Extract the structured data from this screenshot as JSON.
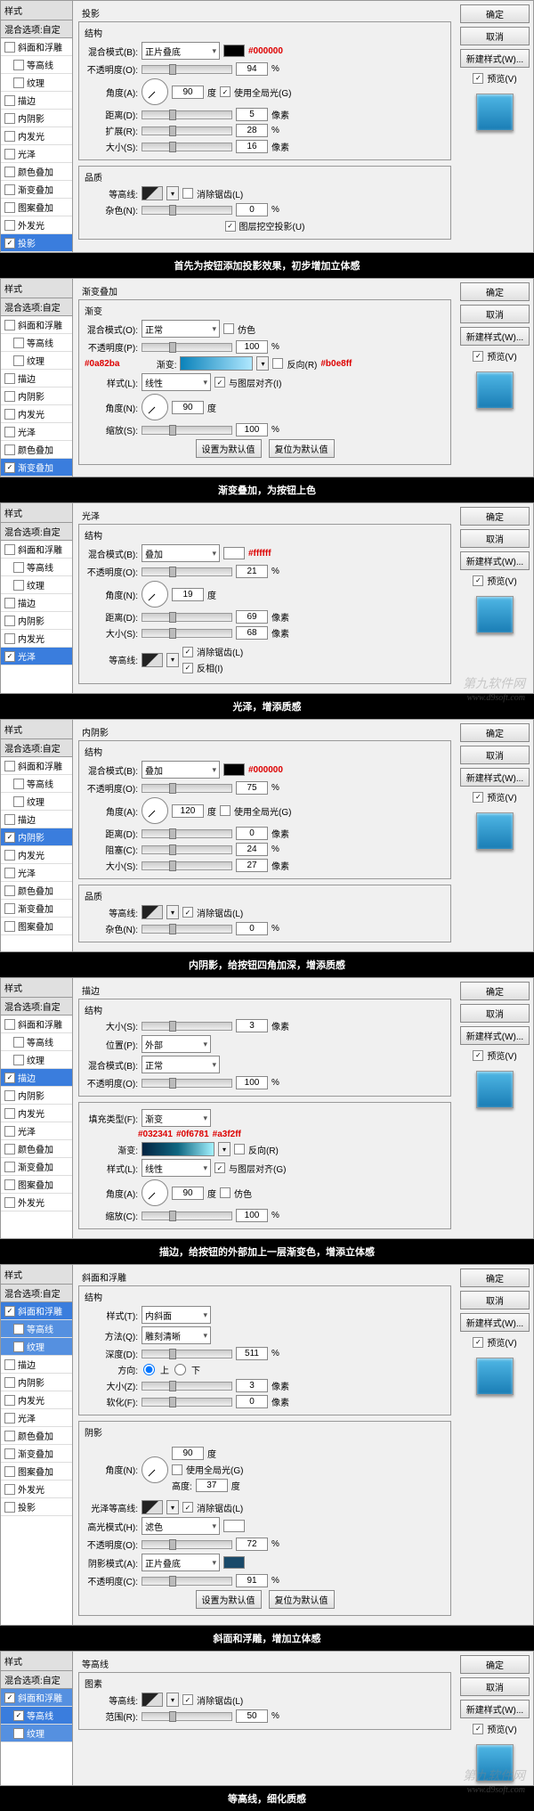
{
  "panels": [
    {
      "sidebar": {
        "hdr": "样式",
        "sub": "混合选项:自定",
        "items": [
          {
            "label": "斜面和浮雕",
            "cb": false
          },
          {
            "label": "等高线",
            "cb": false,
            "indent": 1
          },
          {
            "label": "纹理",
            "cb": false,
            "indent": 1
          },
          {
            "label": "描边",
            "cb": false
          },
          {
            "label": "内阴影",
            "cb": false
          },
          {
            "label": "内发光",
            "cb": false
          },
          {
            "label": "光泽",
            "cb": false
          },
          {
            "label": "颜色叠加",
            "cb": false
          },
          {
            "label": "渐变叠加",
            "cb": false
          },
          {
            "label": "图案叠加",
            "cb": false
          },
          {
            "label": "外发光",
            "cb": false
          },
          {
            "label": "投影",
            "cb": true,
            "active": true
          }
        ]
      },
      "title": "投影",
      "groups": [
        {
          "gtitle": "结构",
          "rows": [
            {
              "t": "blend",
              "lbl": "混合模式(B):",
              "val": "正片叠底",
              "swatch": "#000",
              "hex": "#000000"
            },
            {
              "t": "slider",
              "lbl": "不透明度(O):",
              "num": "94",
              "unit": "%"
            },
            {
              "t": "angle",
              "lbl": "角度(A):",
              "num": "90",
              "unit": "度",
              "chk": [
                "使用全局光(G)",
                true
              ]
            },
            {
              "t": "slider",
              "lbl": "距离(D):",
              "num": "5",
              "unit": "像素"
            },
            {
              "t": "slider",
              "lbl": "扩展(R):",
              "num": "28",
              "unit": "%"
            },
            {
              "t": "slider",
              "lbl": "大小(S):",
              "num": "16",
              "unit": "像素"
            }
          ]
        },
        {
          "gtitle": "品质",
          "rows": [
            {
              "t": "contour",
              "lbl": "等高线:",
              "chk": [
                "消除锯齿(L)",
                false
              ]
            },
            {
              "t": "slider",
              "lbl": "杂色(N):",
              "num": "0",
              "unit": "%"
            },
            {
              "t": "chkrow",
              "chk": [
                "图层挖空投影(U)",
                true
              ]
            }
          ]
        }
      ],
      "caption": "首先为按钮添加投影效果，初步增加立体感"
    },
    {
      "sidebar": {
        "hdr": "样式",
        "sub": "混合选项:自定",
        "items": [
          {
            "label": "斜面和浮雕",
            "cb": false
          },
          {
            "label": "等高线",
            "cb": false,
            "indent": 1
          },
          {
            "label": "纹理",
            "cb": false,
            "indent": 1
          },
          {
            "label": "描边",
            "cb": false
          },
          {
            "label": "内阴影",
            "cb": false
          },
          {
            "label": "内发光",
            "cb": false
          },
          {
            "label": "光泽",
            "cb": false
          },
          {
            "label": "颜色叠加",
            "cb": false
          },
          {
            "label": "渐变叠加",
            "cb": true,
            "active": true
          }
        ]
      },
      "title": "渐变叠加",
      "groups": [
        {
          "gtitle": "渐变",
          "rows": [
            {
              "t": "blend",
              "lbl": "混合模式(O):",
              "val": "正常",
              "chk": [
                "仿色",
                false
              ]
            },
            {
              "t": "slider",
              "lbl": "不透明度(P):",
              "num": "100",
              "unit": "%"
            },
            {
              "t": "grad",
              "lbl": "渐变:",
              "hex1": "#0a82ba",
              "hex2": "#b0e8ff",
              "chk": [
                "反向(R)",
                false
              ]
            },
            {
              "t": "select",
              "lbl": "样式(L):",
              "val": "线性",
              "chk": [
                "与图层对齐(I)",
                true
              ]
            },
            {
              "t": "angle",
              "lbl": "角度(N):",
              "num": "90",
              "unit": "度"
            },
            {
              "t": "slider",
              "lbl": "缩放(S):",
              "num": "100",
              "unit": "%"
            },
            {
              "t": "btns",
              "b1": "设置为默认值",
              "b2": "复位为默认值"
            }
          ]
        }
      ],
      "caption": "渐变叠加，为按钮上色"
    },
    {
      "sidebar": {
        "hdr": "样式",
        "sub": "混合选项:自定",
        "items": [
          {
            "label": "斜面和浮雕",
            "cb": false
          },
          {
            "label": "等高线",
            "cb": false,
            "indent": 1
          },
          {
            "label": "纹理",
            "cb": false,
            "indent": 1
          },
          {
            "label": "描边",
            "cb": false
          },
          {
            "label": "内阴影",
            "cb": false
          },
          {
            "label": "内发光",
            "cb": false
          },
          {
            "label": "光泽",
            "cb": true,
            "active": true
          }
        ]
      },
      "title": "光泽",
      "groups": [
        {
          "gtitle": "结构",
          "rows": [
            {
              "t": "blend",
              "lbl": "混合模式(B):",
              "val": "叠加",
              "swatch": "#fff",
              "hex": "#ffffff"
            },
            {
              "t": "slider",
              "lbl": "不透明度(O):",
              "num": "21",
              "unit": "%"
            },
            {
              "t": "angle",
              "lbl": "角度(N):",
              "num": "19",
              "unit": "度"
            },
            {
              "t": "slider",
              "lbl": "距离(D):",
              "num": "69",
              "unit": "像素"
            },
            {
              "t": "slider",
              "lbl": "大小(S):",
              "num": "68",
              "unit": "像素"
            },
            {
              "t": "contour2",
              "lbl": "等高线:",
              "chk1": [
                "消除锯齿(L)",
                true
              ],
              "chk2": [
                "反相(I)",
                true
              ]
            }
          ]
        }
      ],
      "caption": "光泽，增添质感",
      "wm": true
    },
    {
      "sidebar": {
        "hdr": "样式",
        "sub": "混合选项:自定",
        "items": [
          {
            "label": "斜面和浮雕",
            "cb": false
          },
          {
            "label": "等高线",
            "cb": false,
            "indent": 1
          },
          {
            "label": "纹理",
            "cb": false,
            "indent": 1
          },
          {
            "label": "描边",
            "cb": false
          },
          {
            "label": "内阴影",
            "cb": true,
            "active": true
          },
          {
            "label": "内发光",
            "cb": false
          },
          {
            "label": "光泽",
            "cb": false
          },
          {
            "label": "颜色叠加",
            "cb": false
          },
          {
            "label": "渐变叠加",
            "cb": false
          },
          {
            "label": "图案叠加",
            "cb": false
          }
        ]
      },
      "title": "内阴影",
      "groups": [
        {
          "gtitle": "结构",
          "rows": [
            {
              "t": "blend",
              "lbl": "混合模式(B):",
              "val": "叠加",
              "swatch": "#000",
              "hex": "#000000"
            },
            {
              "t": "slider",
              "lbl": "不透明度(O):",
              "num": "75",
              "unit": "%"
            },
            {
              "t": "angle",
              "lbl": "角度(A):",
              "num": "120",
              "unit": "度",
              "chk": [
                "使用全局光(G)",
                false
              ]
            },
            {
              "t": "slider",
              "lbl": "距离(D):",
              "num": "0",
              "unit": "像素"
            },
            {
              "t": "slider",
              "lbl": "阻塞(C):",
              "num": "24",
              "unit": "%"
            },
            {
              "t": "slider",
              "lbl": "大小(S):",
              "num": "27",
              "unit": "像素"
            }
          ]
        },
        {
          "gtitle": "品质",
          "rows": [
            {
              "t": "contour",
              "lbl": "等高线:",
              "chk": [
                "消除锯齿(L)",
                true
              ]
            },
            {
              "t": "slider",
              "lbl": "杂色(N):",
              "num": "0",
              "unit": "%"
            }
          ]
        }
      ],
      "caption": "内阴影，给按钮四角加深，增添质感"
    },
    {
      "sidebar": {
        "hdr": "样式",
        "sub": "混合选项:自定",
        "items": [
          {
            "label": "斜面和浮雕",
            "cb": false
          },
          {
            "label": "等高线",
            "cb": false,
            "indent": 1
          },
          {
            "label": "纹理",
            "cb": false,
            "indent": 1
          },
          {
            "label": "描边",
            "cb": true,
            "active": true
          },
          {
            "label": "内阴影",
            "cb": false
          },
          {
            "label": "内发光",
            "cb": false
          },
          {
            "label": "光泽",
            "cb": false
          },
          {
            "label": "颜色叠加",
            "cb": false
          },
          {
            "label": "渐变叠加",
            "cb": false
          },
          {
            "label": "图案叠加",
            "cb": false
          },
          {
            "label": "外发光",
            "cb": false
          }
        ]
      },
      "title": "描边",
      "groups": [
        {
          "gtitle": "结构",
          "rows": [
            {
              "t": "slider",
              "lbl": "大小(S):",
              "num": "3",
              "unit": "像素"
            },
            {
              "t": "select",
              "lbl": "位置(P):",
              "val": "外部"
            },
            {
              "t": "blend",
              "lbl": "混合模式(B):",
              "val": "正常"
            },
            {
              "t": "slider",
              "lbl": "不透明度(O):",
              "num": "100",
              "unit": "%"
            }
          ]
        },
        {
          "gtitle": "",
          "rows": [
            {
              "t": "select",
              "lbl": "填充类型(F):",
              "val": "渐变"
            },
            {
              "t": "grad3",
              "lbl": "渐变:",
              "hex1": "#032341",
              "hex2": "#0f6781",
              "hex3": "#a3f2ff",
              "chk": [
                "反向(R)",
                false
              ]
            },
            {
              "t": "select",
              "lbl": "样式(L):",
              "val": "线性",
              "chk": [
                "与图层对齐(G)",
                true
              ]
            },
            {
              "t": "angle",
              "lbl": "角度(A):",
              "num": "90",
              "unit": "度",
              "chk": [
                "仿色",
                false
              ]
            },
            {
              "t": "slider",
              "lbl": "缩放(C):",
              "num": "100",
              "unit": "%"
            }
          ]
        }
      ],
      "caption": "描边，给按钮的外部加上一层渐变色，增添立体感"
    },
    {
      "sidebar": {
        "hdr": "样式",
        "sub": "混合选项:自定",
        "items": [
          {
            "label": "斜面和浮雕",
            "cb": true,
            "active": true
          },
          {
            "label": "等高线",
            "cb": false,
            "indent": 1,
            "activeA": true
          },
          {
            "label": "纹理",
            "cb": false,
            "indent": 1,
            "activeA": true
          },
          {
            "label": "描边",
            "cb": false
          },
          {
            "label": "内阴影",
            "cb": false
          },
          {
            "label": "内发光",
            "cb": false
          },
          {
            "label": "光泽",
            "cb": false
          },
          {
            "label": "颜色叠加",
            "cb": false
          },
          {
            "label": "渐变叠加",
            "cb": false
          },
          {
            "label": "图案叠加",
            "cb": false
          },
          {
            "label": "外发光",
            "cb": false
          },
          {
            "label": "投影",
            "cb": false
          }
        ]
      },
      "title": "斜面和浮雕",
      "groups": [
        {
          "gtitle": "结构",
          "rows": [
            {
              "t": "select",
              "lbl": "样式(T):",
              "val": "内斜面"
            },
            {
              "t": "select",
              "lbl": "方法(Q):",
              "val": "雕刻清晰"
            },
            {
              "t": "slider",
              "lbl": "深度(D):",
              "num": "511",
              "unit": "%"
            },
            {
              "t": "radio",
              "lbl": "方向:",
              "opts": [
                "上",
                "下"
              ],
              "sel": 0
            },
            {
              "t": "slider",
              "lbl": "大小(Z):",
              "num": "3",
              "unit": "像素"
            },
            {
              "t": "slider",
              "lbl": "软化(F):",
              "num": "0",
              "unit": "像素"
            }
          ]
        },
        {
          "gtitle": "阴影",
          "rows": [
            {
              "t": "angle2",
              "lbl": "角度(N):",
              "num": "90",
              "unit": "度",
              "chk": [
                "使用全局光(G)",
                false
              ],
              "lbl2": "高度:",
              "num2": "37",
              "unit2": "度"
            },
            {
              "t": "contour",
              "lbl": "光泽等高线:",
              "chk": [
                "消除锯齿(L)",
                true
              ]
            },
            {
              "t": "blend",
              "lbl": "高光模式(H):",
              "val": "滤色",
              "swatch": "#fff"
            },
            {
              "t": "slider",
              "lbl": "不透明度(O):",
              "num": "72",
              "unit": "%"
            },
            {
              "t": "blend",
              "lbl": "阴影模式(A):",
              "val": "正片叠底",
              "swatch": "#1a4a6a"
            },
            {
              "t": "slider",
              "lbl": "不透明度(C):",
              "num": "91",
              "unit": "%"
            },
            {
              "t": "btns",
              "b1": "设置为默认值",
              "b2": "复位为默认值"
            }
          ]
        }
      ],
      "caption": "斜面和浮雕，增加立体感"
    },
    {
      "sidebar": {
        "hdr": "样式",
        "sub": "混合选项:自定",
        "items": [
          {
            "label": "斜面和浮雕",
            "cb": true,
            "activeA": true
          },
          {
            "label": "等高线",
            "cb": true,
            "indent": 1,
            "active": true
          },
          {
            "label": "纹理",
            "cb": false,
            "indent": 1,
            "activeA": true
          }
        ]
      },
      "title": "等高线",
      "groups": [
        {
          "gtitle": "图素",
          "rows": [
            {
              "t": "contour",
              "lbl": "等高线:",
              "chk": [
                "消除锯齿(L)",
                true
              ]
            },
            {
              "t": "slider",
              "lbl": "范围(R):",
              "num": "50",
              "unit": "%"
            }
          ]
        }
      ],
      "caption": "等高线，细化质感",
      "wm": true
    }
  ],
  "rpanel": {
    "ok": "确定",
    "cancel": "取消",
    "newstyle": "新建样式(W)...",
    "preview": "预览(V)"
  },
  "watermark": {
    "big": "第九软件网",
    "url": "www.d9soft.com"
  }
}
